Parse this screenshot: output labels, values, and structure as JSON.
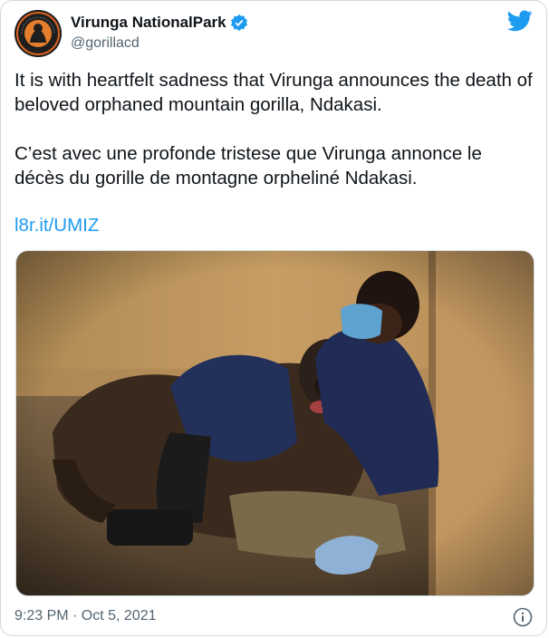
{
  "account": {
    "name": "Virunga NationalPark",
    "handle": "@gorillacd",
    "avatar_text": "VIRUNGA NATIONAL PARK"
  },
  "tweet": {
    "paragraphs": [
      "It is with heartfelt sadness that Virunga announces the death of beloved orphaned mountain gorilla, Ndakasi.",
      "C’est avec une profonde tristese que Virunga annonce le décès du gorille de montagne orpheliné Ndakasi."
    ],
    "link": "l8r.it/UMIZ",
    "timestamp": "9:23 PM · Oct 5, 2021"
  },
  "colors": {
    "accent": "#1d9bf0",
    "text": "#0f1419",
    "muted": "#536471"
  },
  "icons": {
    "verified": "verified-badge-icon",
    "brand": "twitter-bird-icon",
    "info": "info-icon"
  }
}
